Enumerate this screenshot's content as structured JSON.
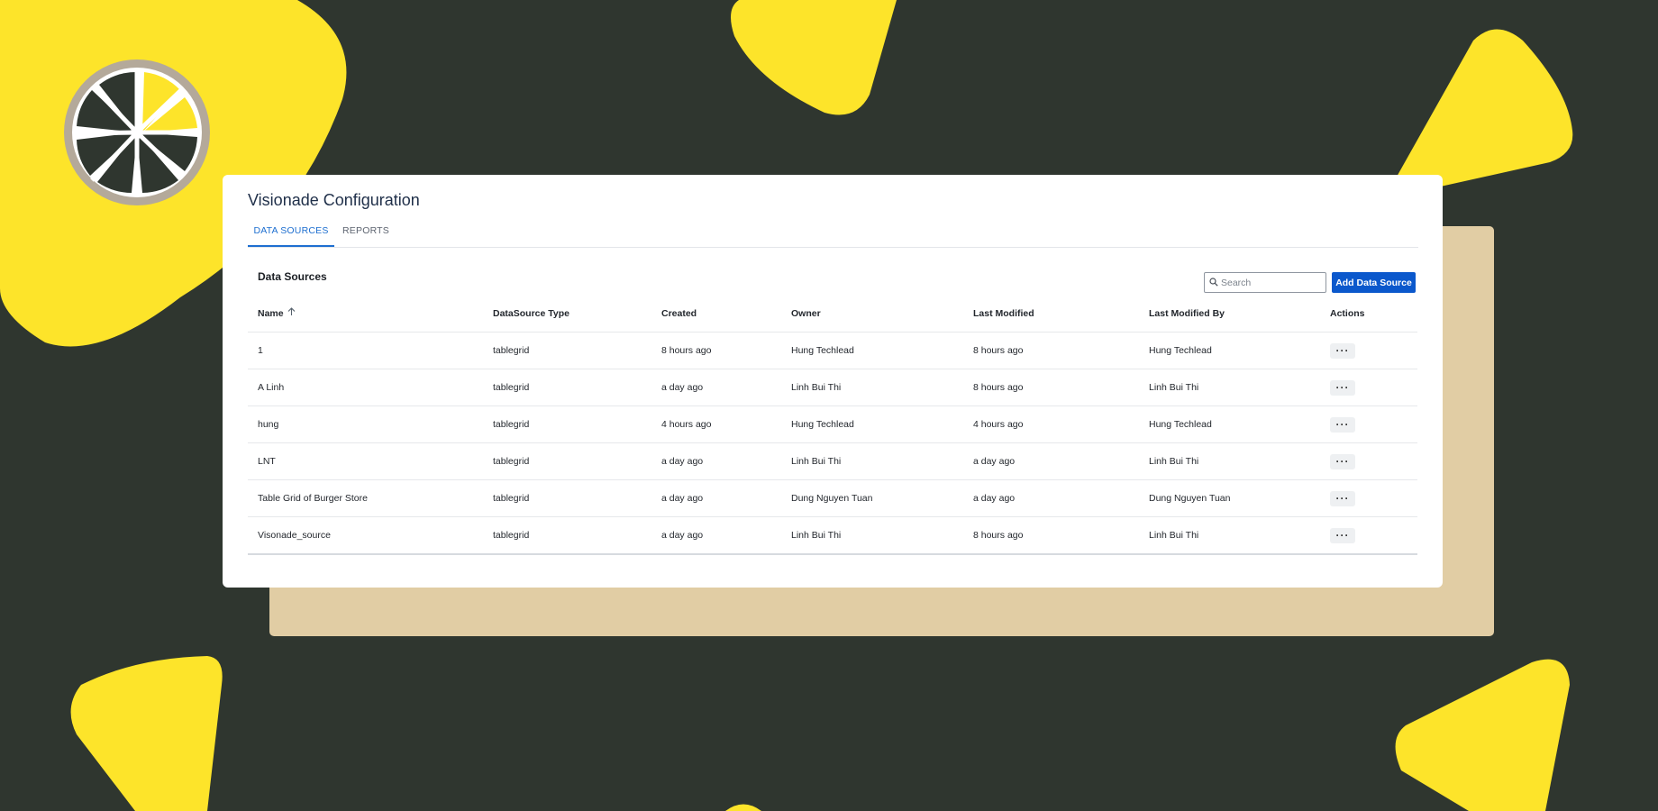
{
  "app": {
    "title": "Visionade Configuration",
    "logo_icon": "lemon-slice-logo"
  },
  "colors": {
    "background": "#2f362f",
    "decor_yellow": "#fde42a",
    "decor_tan": "#e1cda4",
    "accent_blue": "#0b58cc",
    "tab_active": "#1e6fd0"
  },
  "tabs": [
    {
      "label": "DATA SOURCES",
      "active": true
    },
    {
      "label": "REPORTS",
      "active": false
    }
  ],
  "section": {
    "title": "Data Sources",
    "search_placeholder": "Search",
    "search_value": "",
    "add_button_label": "Add Data Source"
  },
  "table": {
    "columns": [
      "Name",
      "DataSource Type",
      "Created",
      "Owner",
      "Last Modified",
      "Last Modified By",
      "Actions"
    ],
    "sorted_column": "Name",
    "sort_direction": "ascending",
    "rows": [
      {
        "name": "1",
        "type": "tablegrid",
        "created": "8 hours ago",
        "owner": "Hung Techlead",
        "last_modified": "8 hours ago",
        "last_modified_by": "Hung Techlead",
        "actions": "···"
      },
      {
        "name": "A Linh",
        "type": "tablegrid",
        "created": "a day ago",
        "owner": "Linh Bui Thi",
        "last_modified": "8 hours ago",
        "last_modified_by": "Linh Bui Thi",
        "actions": "···"
      },
      {
        "name": "hung",
        "type": "tablegrid",
        "created": "4 hours ago",
        "owner": "Hung Techlead",
        "last_modified": "4 hours ago",
        "last_modified_by": "Hung Techlead",
        "actions": "···"
      },
      {
        "name": "LNT",
        "type": "tablegrid",
        "created": "a day ago",
        "owner": "Linh Bui Thi",
        "last_modified": "a day ago",
        "last_modified_by": "Linh Bui Thi",
        "actions": "···"
      },
      {
        "name": "Table Grid of Burger Store",
        "type": "tablegrid",
        "created": "a day ago",
        "owner": "Dung Nguyen Tuan",
        "last_modified": "a day ago",
        "last_modified_by": "Dung Nguyen Tuan",
        "actions": "···"
      },
      {
        "name": "Visonade_source",
        "type": "tablegrid",
        "created": "a day ago",
        "owner": "Linh Bui Thi",
        "last_modified": "8 hours ago",
        "last_modified_by": "Linh Bui Thi",
        "actions": "···"
      }
    ]
  }
}
